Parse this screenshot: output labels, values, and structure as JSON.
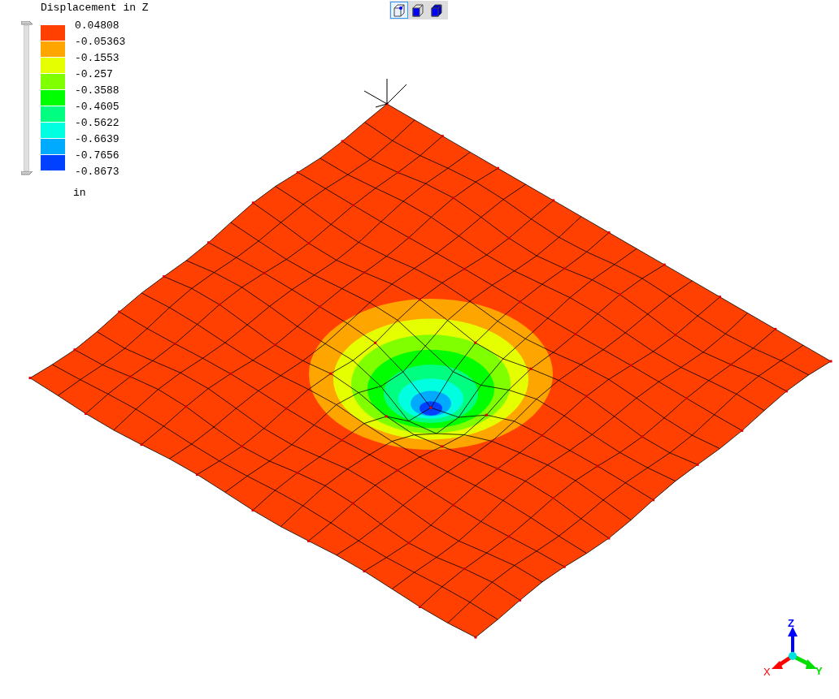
{
  "legend": {
    "title": "Displacement in Z",
    "unit": "in",
    "bands": [
      {
        "color": "#ff4000"
      },
      {
        "color": "#ffa500"
      },
      {
        "color": "#e6ff00"
      },
      {
        "color": "#80ff00"
      },
      {
        "color": "#00ff00"
      },
      {
        "color": "#00ff80"
      },
      {
        "color": "#00ffe0"
      },
      {
        "color": "#00aaff"
      },
      {
        "color": "#0040ff"
      }
    ],
    "labels": [
      "0.04808",
      "-0.05363",
      "-0.1553",
      "-0.257",
      "-0.3588",
      "-0.4605",
      "-0.5622",
      "-0.6639",
      "-0.7656",
      "-0.8673"
    ]
  },
  "toolbar": [
    {
      "kind": "wire",
      "selected": true
    },
    {
      "kind": "solid",
      "selected": false
    },
    {
      "kind": "shaded",
      "selected": false
    }
  ],
  "range": {
    "level": 1
  },
  "triad": {
    "x": "X",
    "y": "Y",
    "z": "Z"
  }
}
